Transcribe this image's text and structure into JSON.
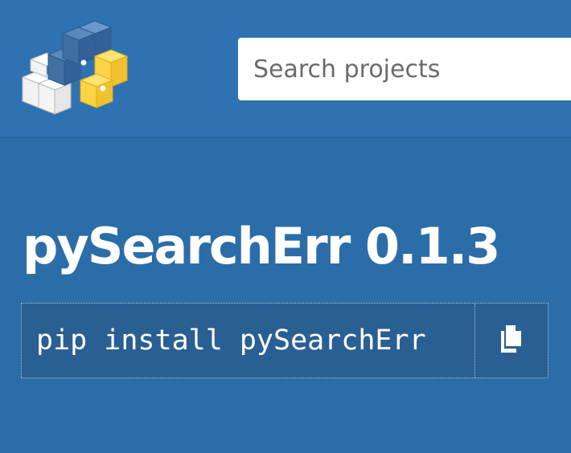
{
  "header": {
    "logo_icon": "pypi-logo-icon",
    "search_placeholder": "Search projects"
  },
  "package": {
    "title": "pySearchErr 0.1.3",
    "install_command": "pip install pySearchErr",
    "copy_icon": "copy-icon"
  },
  "colors": {
    "header_bg": "#2e72b2",
    "body_bg": "#2b6da8",
    "logo_blue": "#3f6fa5",
    "logo_yellow": "#ffd343"
  }
}
